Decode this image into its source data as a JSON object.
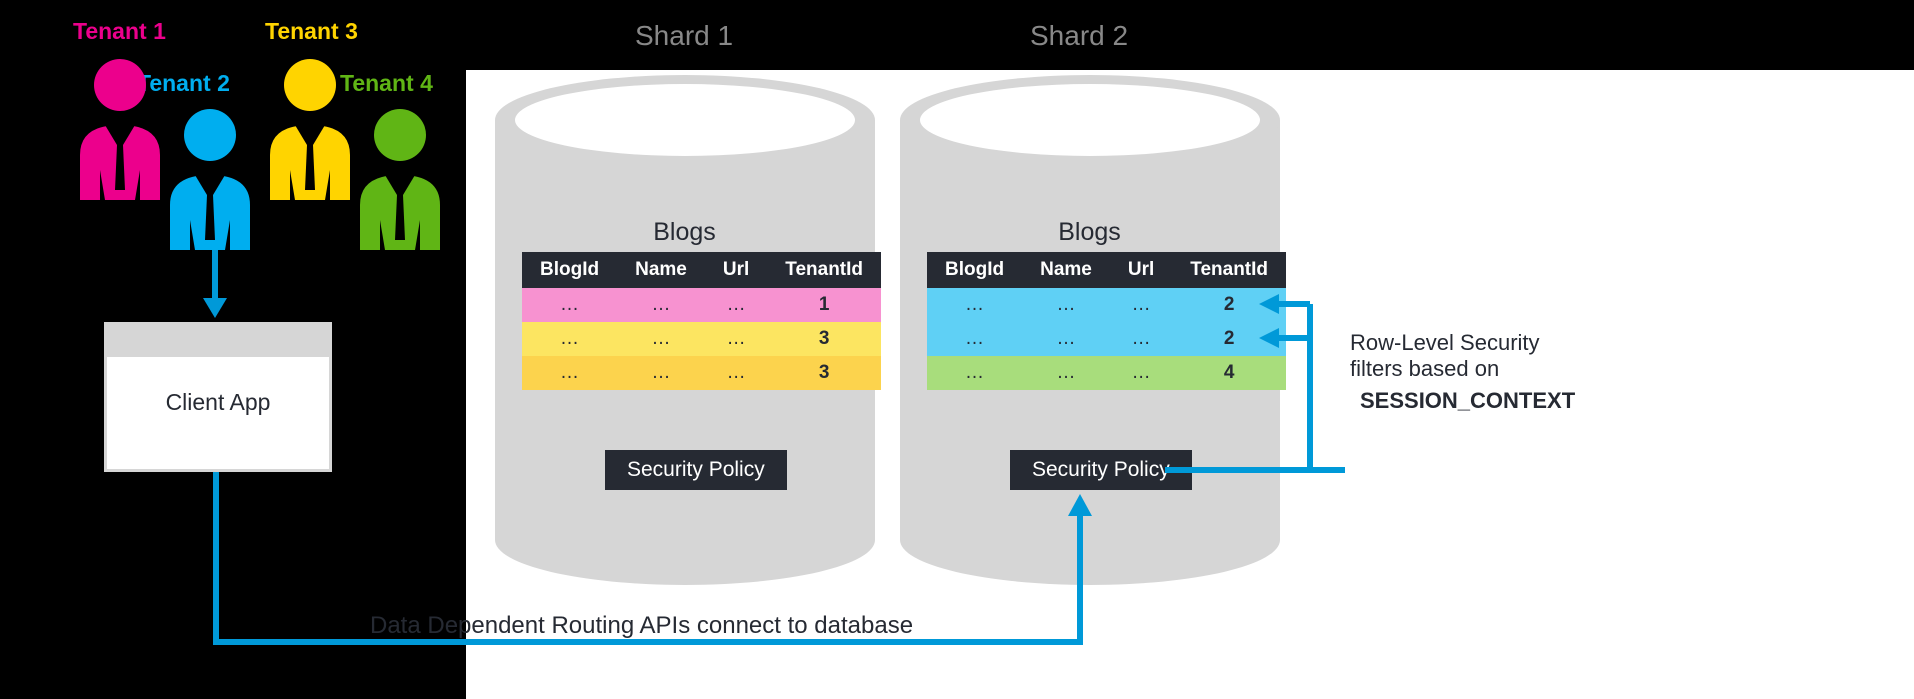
{
  "tenants": [
    {
      "label": "Tenant 1",
      "color": "#ec008c"
    },
    {
      "label": "Tenant 2",
      "color": "#00aeef"
    },
    {
      "label": "Tenant 3",
      "color": "#ffd400"
    },
    {
      "label": "Tenant 4",
      "color": "#60b515"
    }
  ],
  "shards": [
    {
      "title": "Shard 1"
    },
    {
      "title": "Shard 2"
    }
  ],
  "table": {
    "title": "Blogs",
    "columns": [
      "BlogId",
      "Name",
      "Url",
      "TenantId"
    ],
    "security_policy": "Security Policy"
  },
  "shard1_rows": [
    {
      "cells": [
        "…",
        "…",
        "…",
        "1"
      ],
      "bg": "#f792d0"
    },
    {
      "cells": [
        "…",
        "…",
        "…",
        "3"
      ],
      "bg": "#fce561"
    },
    {
      "cells": [
        "…",
        "…",
        "…",
        "3"
      ],
      "bg": "#fcd34d"
    }
  ],
  "shard2_rows": [
    {
      "cells": [
        "…",
        "…",
        "…",
        "2"
      ],
      "bg": "#5fd0f5"
    },
    {
      "cells": [
        "…",
        "…",
        "…",
        "2"
      ],
      "bg": "#5fd0f5"
    },
    {
      "cells": [
        "…",
        "…",
        "…",
        "4"
      ],
      "bg": "#a8dd7c"
    }
  ],
  "client_app": "Client App",
  "ddr_label": "Data Dependent Routing APIs connect to database",
  "rls": {
    "line1": "Row-Level Security",
    "line2": "filters based on",
    "line3": "SESSION_CONTEXT"
  },
  "colors": {
    "arrow": "#0099d8",
    "cylinder_fill": "#d6d6d6",
    "cylinder_top": "#ffffff"
  }
}
